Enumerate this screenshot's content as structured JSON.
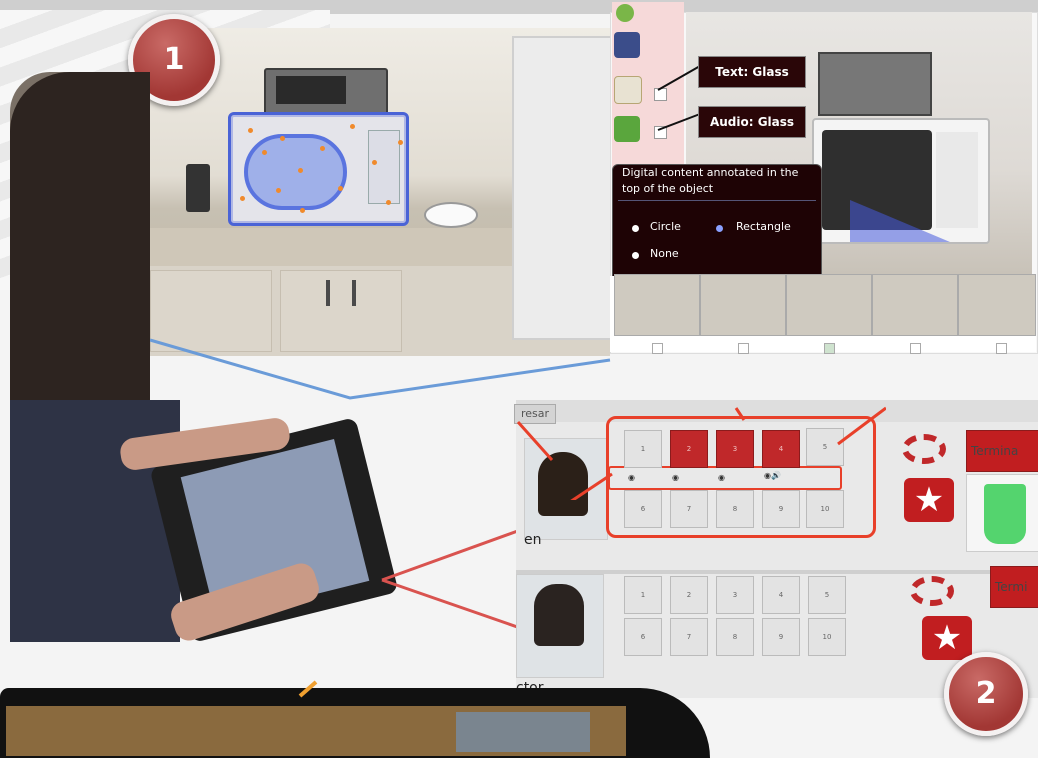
{
  "badges": {
    "step1": "1",
    "step2": "2"
  },
  "annotation_editor": {
    "text_label": "Text: Glass",
    "audio_label": "Audio: Glass",
    "popup": {
      "title": "Digital content annotated in the top of the object",
      "options": [
        {
          "label": "Circle",
          "selected": false
        },
        {
          "label": "Rectangle",
          "selected": true
        },
        {
          "label": "None",
          "selected": false
        }
      ]
    },
    "thumbnails_checked": [
      false,
      false,
      true,
      false,
      false
    ],
    "colors": {
      "popup_bg": "#1e0305",
      "annotation_blue": "#4a63d6",
      "toolbar_pink": "#f6d9d9"
    }
  },
  "classroom_app": {
    "top_button": "resar",
    "terminar_label": "Termina",
    "terminar_label_2": "Termi",
    "students": [
      {
        "name_fragment": "en",
        "squares": [
          "1",
          "2",
          "3",
          "4",
          "5",
          "6",
          "7",
          "8",
          "9",
          "10"
        ],
        "completed": [
          true,
          true,
          true,
          true,
          false,
          false,
          false,
          false,
          false,
          false
        ]
      },
      {
        "name_fragment": "ctor",
        "squares": [
          "1",
          "2",
          "3",
          "4",
          "5",
          "6",
          "7",
          "8",
          "9",
          "10"
        ],
        "completed": [
          false,
          false,
          false,
          false,
          false,
          false,
          false,
          false,
          false,
          false
        ]
      }
    ],
    "colors": {
      "accent_red": "#c11e20",
      "highlight": "#e8402a",
      "cup_green": "#54d46e"
    }
  }
}
